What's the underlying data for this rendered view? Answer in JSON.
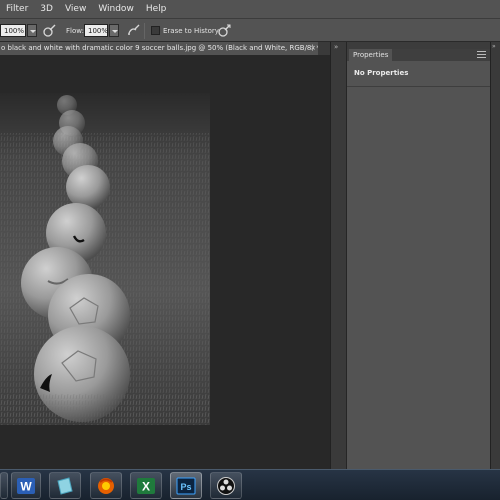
{
  "menu": [
    "Filter",
    "3D",
    "View",
    "Window",
    "Help"
  ],
  "options_bar": {
    "opacity_value": "100%",
    "flow_label": "Flow:",
    "flow_value": "100%",
    "erase_to_history_label": "Erase to History",
    "airbrush_icon": "airbrush-icon",
    "pressure_opacity_icon": "pressure-icon",
    "pressure_size_icon": "pressure-size-icon"
  },
  "document": {
    "tab_title": "o black and white with dramatic color 9 soccer balls.jpg @ 50% (Black and White, RGB/8) *",
    "close_glyph": "×",
    "image": "grayscale photo of soccer balls lined up on grass"
  },
  "panel": {
    "tab_label": "Properties",
    "content": "No Properties",
    "collapse_glyph": "»",
    "menu_icon": "panel-menu-icon"
  },
  "taskbar": {
    "apps": [
      "word-icon",
      "file-icon",
      "firefox-icon",
      "excel-icon",
      "photoshop-icon",
      "obs-icon"
    ],
    "word_letter": "W",
    "excel_letter": "X",
    "photoshop_letter": "Ps"
  },
  "colors": {
    "ui_panel": "#535353",
    "ui_dark": "#282828",
    "taskbar": "#1f2b39"
  }
}
